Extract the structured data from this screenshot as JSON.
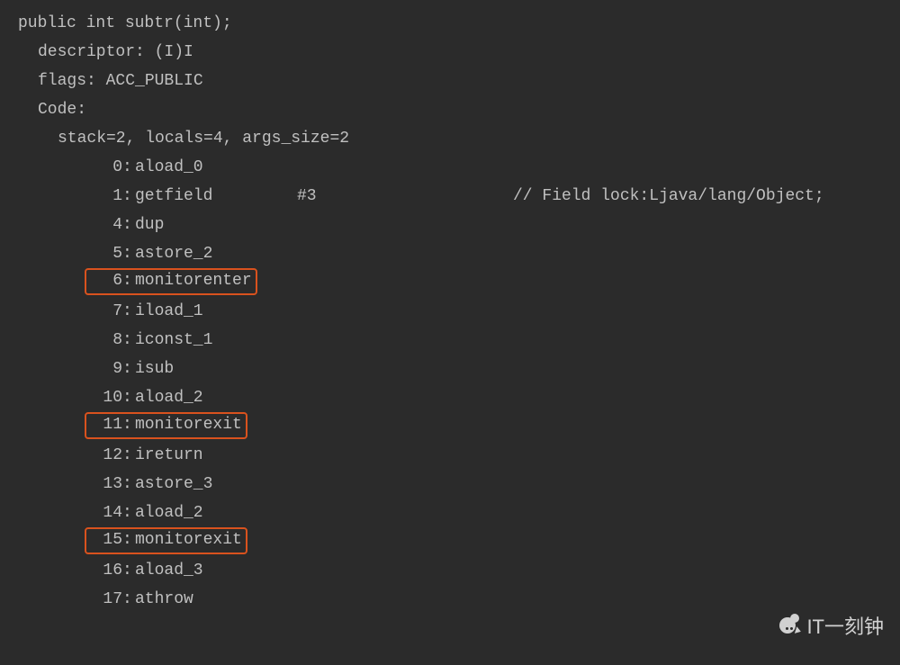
{
  "code": {
    "header": [
      {
        "indent": 0,
        "text": "public int subtr(int);"
      },
      {
        "indent": 1,
        "text": "descriptor: (I)I"
      },
      {
        "indent": 1,
        "text": "flags: ACC_PUBLIC"
      },
      {
        "indent": 1,
        "text": "Code:"
      },
      {
        "indent": 2,
        "text": "stack=2, locals=4, args_size=2"
      }
    ],
    "bytecode": [
      {
        "offset": "0",
        "opcode": "aload_0",
        "arg": "",
        "comment": "",
        "hl": false
      },
      {
        "offset": "1",
        "opcode": "getfield",
        "arg": "#3",
        "comment": "// Field lock:Ljava/lang/Object;",
        "hl": false
      },
      {
        "offset": "4",
        "opcode": "dup",
        "arg": "",
        "comment": "",
        "hl": false
      },
      {
        "offset": "5",
        "opcode": "astore_2",
        "arg": "",
        "comment": "",
        "hl": false
      },
      {
        "offset": "6",
        "opcode": "monitorenter",
        "arg": "",
        "comment": "",
        "hl": true
      },
      {
        "offset": "7",
        "opcode": "iload_1",
        "arg": "",
        "comment": "",
        "hl": false
      },
      {
        "offset": "8",
        "opcode": "iconst_1",
        "arg": "",
        "comment": "",
        "hl": false
      },
      {
        "offset": "9",
        "opcode": "isub",
        "arg": "",
        "comment": "",
        "hl": false
      },
      {
        "offset": "10",
        "opcode": "aload_2",
        "arg": "",
        "comment": "",
        "hl": false
      },
      {
        "offset": "11",
        "opcode": "monitorexit",
        "arg": "",
        "comment": "",
        "hl": true
      },
      {
        "offset": "12",
        "opcode": "ireturn",
        "arg": "",
        "comment": "",
        "hl": false
      },
      {
        "offset": "13",
        "opcode": "astore_3",
        "arg": "",
        "comment": "",
        "hl": false
      },
      {
        "offset": "14",
        "opcode": "aload_2",
        "arg": "",
        "comment": "",
        "hl": false
      },
      {
        "offset": "15",
        "opcode": "monitorexit",
        "arg": "",
        "comment": "",
        "hl": true
      },
      {
        "offset": "16",
        "opcode": "aload_3",
        "arg": "",
        "comment": "",
        "hl": false
      },
      {
        "offset": "17",
        "opcode": "athrow",
        "arg": "",
        "comment": "",
        "hl": false
      }
    ]
  },
  "watermark": {
    "text": "IT一刻钟"
  }
}
